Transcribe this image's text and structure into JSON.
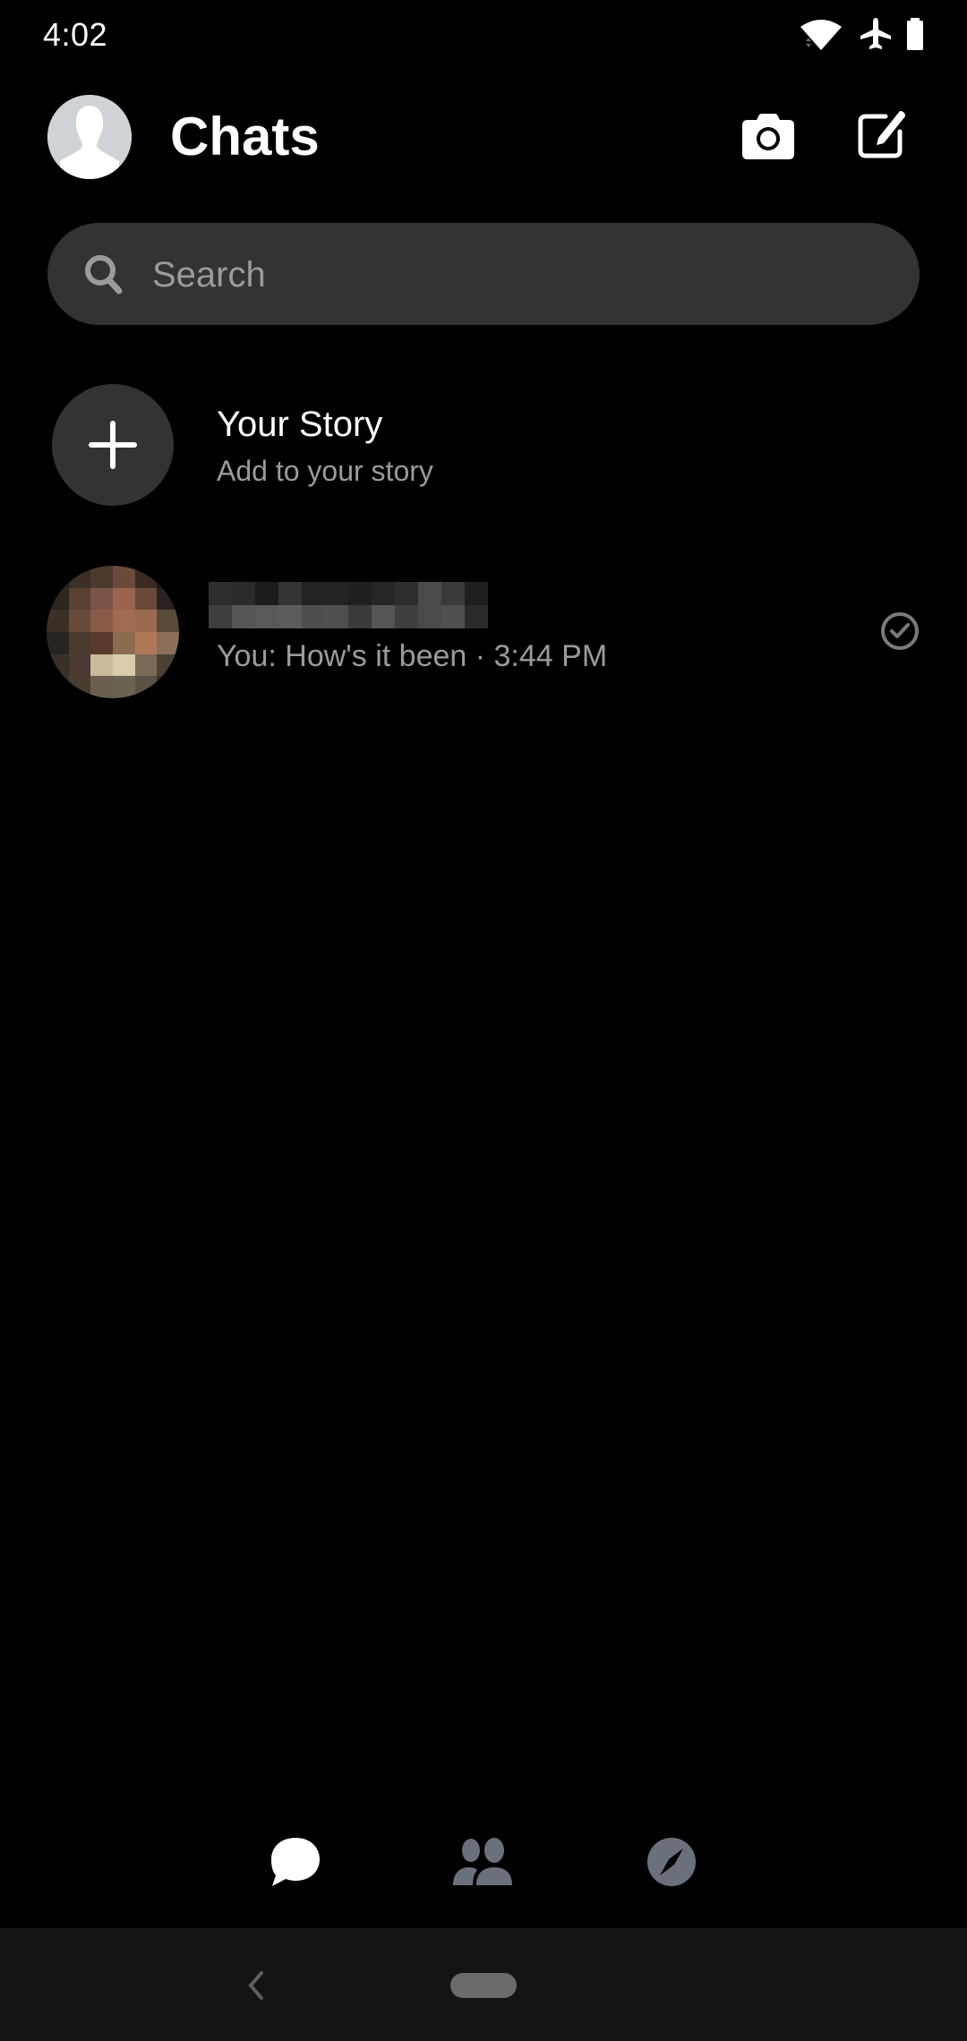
{
  "status_bar": {
    "time": "4:02",
    "icons": [
      "wifi-icon",
      "airplane-mode-icon",
      "battery-icon"
    ]
  },
  "header": {
    "title": "Chats",
    "actions": [
      {
        "name": "camera-button",
        "icon": "camera-icon"
      },
      {
        "name": "compose-button",
        "icon": "compose-icon"
      }
    ]
  },
  "search": {
    "placeholder": "Search",
    "value": ""
  },
  "story": {
    "title": "Your Story",
    "subtitle": "Add to your story",
    "icon": "plus-icon"
  },
  "chats": [
    {
      "name": "[redacted]",
      "preview": "You: How's it been · 3:44 PM",
      "status_icon": "sent-check-icon",
      "avatar_colors": [
        "#2a221e",
        "#3c2f27",
        "#4a3a30",
        "#6a4a3c",
        "#3a2a22",
        "#1e1814",
        "#2c2520",
        "#5a4033",
        "#7a5545",
        "#9a6450",
        "#6a4a3a",
        "#2a2220",
        "#3a3028",
        "#6a4a3a",
        "#8a5a48",
        "#a06a55",
        "#9a6a50",
        "#5a4a3a",
        "#2a2420",
        "#4a3a30",
        "#5a3a2c",
        "#8a6a50",
        "#b07858",
        "#8a7058",
        "#3a302a",
        "#4a3a32",
        "#c8bc9a",
        "#d8ccaa",
        "#7a6a58",
        "#4a4036",
        "#3a3028",
        "#4a3c32",
        "#6a6050",
        "#6a6252",
        "#5a5244",
        "#3a342c"
      ],
      "name_blur_colors": [
        "#2e2e2e",
        "#2a2a2a",
        "#1c1c1c",
        "#333333",
        "#232323",
        "#232323",
        "#1f1f1f",
        "#262626",
        "#2e2e2e",
        "#4a4a4a",
        "#3a3a3a",
        "#1e1e1e",
        "#3e3e3e",
        "#555555",
        "#595959",
        "#5c5c5c",
        "#4e4e4e",
        "#4f4f4f",
        "#3a3a3a",
        "#555555",
        "#3f3f3f",
        "#4a4a4a",
        "#505050",
        "#2a2a2a"
      ]
    }
  ],
  "bottom_nav": {
    "tabs": [
      {
        "name": "tab-chats",
        "icon": "chat-bubble-icon",
        "active": true
      },
      {
        "name": "tab-people",
        "icon": "people-icon",
        "active": false
      },
      {
        "name": "tab-discover",
        "icon": "compass-icon",
        "active": false
      }
    ],
    "active_color": "#ffffff",
    "inactive_color": "#6a717d"
  },
  "system_nav": {
    "back": "back-chevron-icon",
    "home": "home-pill"
  }
}
